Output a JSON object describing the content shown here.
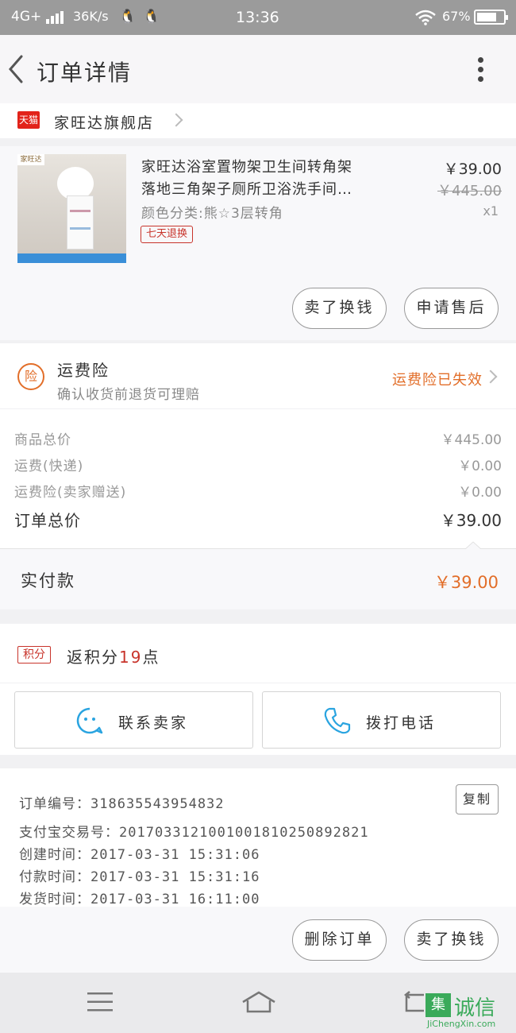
{
  "status_bar": {
    "network": "4G+",
    "speed": "36K/s",
    "time": "13:36",
    "battery": "67%"
  },
  "header": {
    "title": "订单详情"
  },
  "store": {
    "platform_badge": "天猫",
    "name": "家旺达旗舰店"
  },
  "product": {
    "image_brand": "家旺达",
    "title_line1": "家旺达浴室置物架卫生间转角架",
    "title_line2": "落地三角架子厕所卫浴洗手间…",
    "sku": "颜色分类:熊☆3层转角",
    "service_tag": "七天退换",
    "price": "￥39.00",
    "original_price": "￥445.00",
    "quantity": "x1",
    "buttons": [
      "卖了换钱",
      "申请售后"
    ]
  },
  "insurance": {
    "icon_text": "险",
    "title": "运费险",
    "subtitle": "确认收货前退货可理赔",
    "status": "运费险已失效"
  },
  "totals": {
    "rows": [
      {
        "label": "商品总价",
        "value": "￥445.00"
      },
      {
        "label": "运费(快递)",
        "value": "￥0.00"
      },
      {
        "label": "运费险(卖家赠送)",
        "value": "￥0.00"
      }
    ],
    "order_total_label": "订单总价",
    "order_total_value": "￥39.00",
    "paid_label": "实付款",
    "paid_value": "￥39.00"
  },
  "points": {
    "badge": "积分",
    "prefix": "返积分",
    "count": "19",
    "suffix": "点"
  },
  "contact": {
    "seller_label": "联系卖家",
    "phone_label": "拨打电话"
  },
  "order_info": {
    "lines": [
      "订单编号：318635543954832",
      "支付宝交易号：2017033121001001810250892821",
      "创建时间：2017-03-31 15:31:06",
      "付款时间：2017-03-31 15:31:16",
      "发货时间：2017-03-31 16:11:00"
    ],
    "copy_label": "复制"
  },
  "footer": {
    "buttons": [
      "删除订单",
      "卖了换钱"
    ]
  },
  "watermark": {
    "text": "诚信",
    "url_text": "JiChengXin.com"
  },
  "colors": {
    "accent_orange": "#e26e29",
    "tmall_red": "#e2231a",
    "points_red": "#c8342b"
  }
}
